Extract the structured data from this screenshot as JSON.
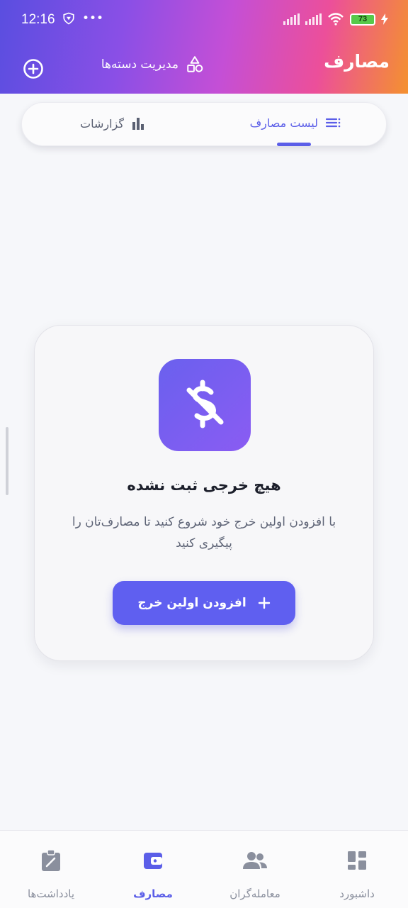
{
  "status_bar": {
    "time": "12:16",
    "more": "•••",
    "battery": "73"
  },
  "header": {
    "title": "مصارف",
    "manage_categories": "مدیریت دسته‌ها"
  },
  "tabs": [
    {
      "label": "لیست مصارف",
      "active": true,
      "icon": "list-icon"
    },
    {
      "label": "گزارشات",
      "active": false,
      "icon": "bar-chart-icon"
    }
  ],
  "empty_state": {
    "icon": "money-off-icon",
    "title": "هیچ خرجی ثبت نشده",
    "description": "با افزودن اولین خرج خود شروع کنید تا مصارف‌تان را پیگیری کنید",
    "button_label": "افزودن اولین خرج"
  },
  "bottom_nav": [
    {
      "label": "داشبورد",
      "icon": "dashboard-icon",
      "active": false
    },
    {
      "label": "معامله‌گران",
      "icon": "people-icon",
      "active": false
    },
    {
      "label": "مصارف",
      "icon": "wallet-icon",
      "active": true
    },
    {
      "label": "یادداشت‌ها",
      "icon": "note-icon",
      "active": false
    }
  ],
  "colors": {
    "accent": "#5b5ee8",
    "header_gradient_start": "#5a4ee0",
    "header_gradient_end": "#f4912f",
    "battery_green": "#57c94a"
  }
}
